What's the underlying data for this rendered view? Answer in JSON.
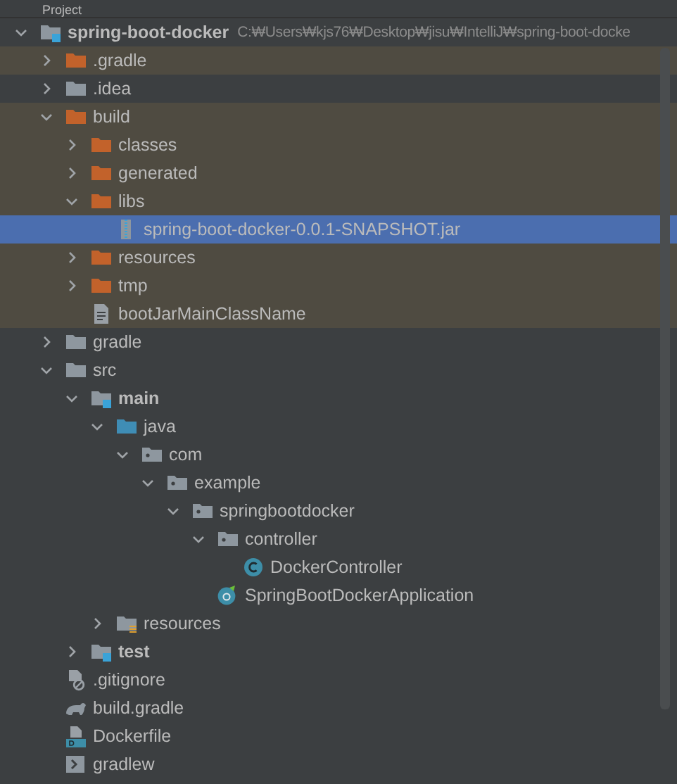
{
  "panel": {
    "title": "Project"
  },
  "tree": [
    {
      "label": "spring-boot-docker",
      "path": "C:₩Users₩kjs76₩Desktop₩jisu₩IntelliJ₩spring-boot-docke",
      "kind": "module",
      "expanded": true,
      "excluded": false,
      "selected": false,
      "children": [
        {
          "label": ".gradle",
          "kind": "folder",
          "expanded": false,
          "excluded": true,
          "selected": false
        },
        {
          "label": ".idea",
          "kind": "folder",
          "expanded": false,
          "excluded": false,
          "selected": false
        },
        {
          "label": "build",
          "kind": "folder",
          "expanded": true,
          "excluded": true,
          "selected": false,
          "children": [
            {
              "label": "classes",
              "kind": "folder",
              "expanded": false,
              "excluded": true,
              "selected": false
            },
            {
              "label": "generated",
              "kind": "folder",
              "expanded": false,
              "excluded": true,
              "selected": false
            },
            {
              "label": "libs",
              "kind": "folder",
              "expanded": true,
              "excluded": true,
              "selected": false,
              "children": [
                {
                  "label": "spring-boot-docker-0.0.1-SNAPSHOT.jar",
                  "kind": "jar",
                  "selected": true
                }
              ]
            },
            {
              "label": "resources",
              "kind": "folder",
              "expanded": false,
              "excluded": true,
              "selected": false
            },
            {
              "label": "tmp",
              "kind": "folder",
              "expanded": false,
              "excluded": true,
              "selected": false
            },
            {
              "label": "bootJarMainClassName",
              "kind": "text-file",
              "excluded": true,
              "selected": false
            }
          ]
        },
        {
          "label": "gradle",
          "kind": "folder",
          "expanded": false,
          "excluded": false,
          "selected": false
        },
        {
          "label": "src",
          "kind": "folder",
          "expanded": true,
          "excluded": false,
          "selected": false,
          "children": [
            {
              "label": "main",
              "kind": "module",
              "expanded": true,
              "excluded": false,
              "selected": false,
              "children": [
                {
                  "label": "java",
                  "kind": "source-folder",
                  "expanded": true,
                  "excluded": false,
                  "selected": false,
                  "children": [
                    {
                      "label": "com",
                      "kind": "package",
                      "expanded": true,
                      "excluded": false,
                      "selected": false,
                      "children": [
                        {
                          "label": "example",
                          "kind": "package",
                          "expanded": true,
                          "excluded": false,
                          "selected": false,
                          "children": [
                            {
                              "label": "springbootdocker",
                              "kind": "package",
                              "expanded": true,
                              "excluded": false,
                              "selected": false,
                              "children": [
                                {
                                  "label": "controller",
                                  "kind": "package",
                                  "expanded": true,
                                  "excluded": false,
                                  "selected": false,
                                  "children": [
                                    {
                                      "label": "DockerController",
                                      "kind": "class",
                                      "excluded": false,
                                      "selected": false
                                    }
                                  ]
                                },
                                {
                                  "label": "SpringBootDockerApplication",
                                  "kind": "spring-app",
                                  "excluded": false,
                                  "selected": false
                                }
                              ]
                            }
                          ]
                        }
                      ]
                    }
                  ]
                },
                {
                  "label": "resources",
                  "kind": "resources-folder",
                  "expanded": false,
                  "excluded": false,
                  "selected": false
                }
              ]
            },
            {
              "label": "test",
              "kind": "module",
              "expanded": false,
              "excluded": false,
              "selected": false
            }
          ]
        },
        {
          "label": ".gitignore",
          "kind": "gitignore",
          "excluded": false,
          "selected": false
        },
        {
          "label": "build.gradle",
          "kind": "gradle-file",
          "excluded": false,
          "selected": false
        },
        {
          "label": "Dockerfile",
          "kind": "dockerfile",
          "excluded": false,
          "selected": false
        },
        {
          "label": "gradlew",
          "kind": "script",
          "excluded": false,
          "selected": false
        }
      ]
    }
  ]
}
